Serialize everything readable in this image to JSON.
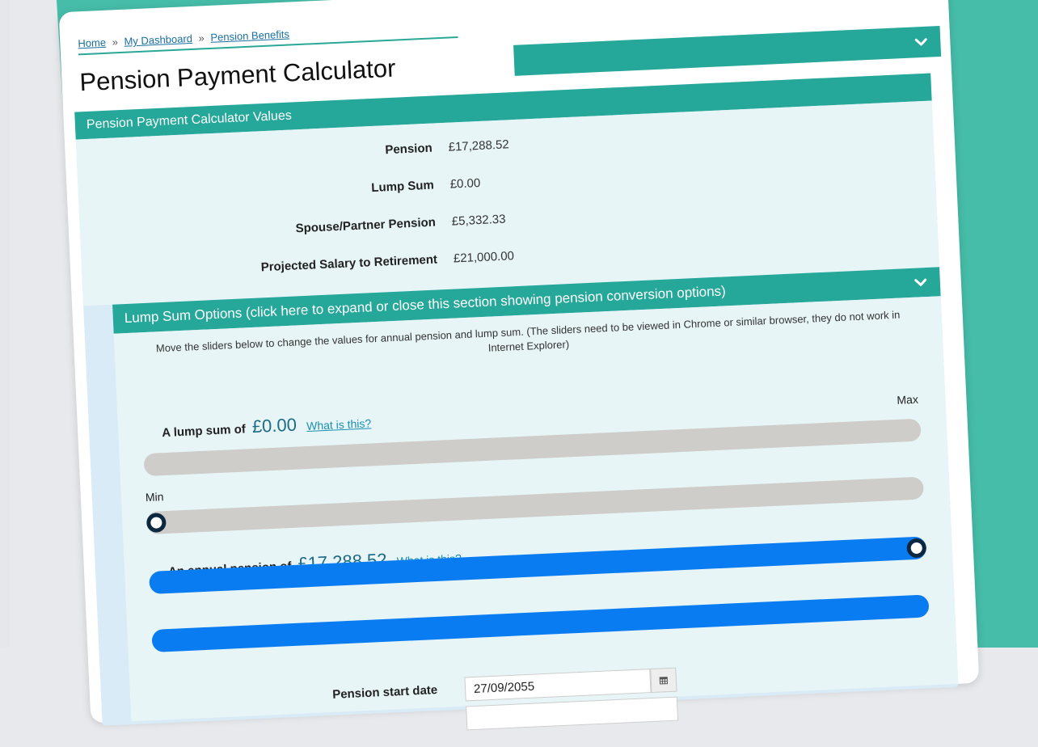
{
  "breadcrumb": {
    "home": "Home",
    "sep": "»",
    "dashboard": "My Dashboard",
    "benefits": "Pension Benefits"
  },
  "page": {
    "title": "Pension Payment Calculator"
  },
  "values_section": {
    "header": "Pension Payment Calculator Values",
    "rows": [
      {
        "label": "Pension",
        "value": "£17,288.52"
      },
      {
        "label": "Lump Sum",
        "value": "£0.00"
      },
      {
        "label": "Spouse/Partner Pension",
        "value": "£5,332.33"
      },
      {
        "label": "Projected Salary to Retirement",
        "value": "£21,000.00"
      }
    ]
  },
  "lump_options": {
    "header": "Lump Sum Options (click here to expand or close this section showing pension conversion options)",
    "instructions": "Move the sliders below to change the values for annual pension and lump sum. (The sliders need to be viewed in Chrome or similar browser, they do not work in Internet Explorer)",
    "lump_sum": {
      "prefix": "A lump sum of",
      "amount": "£0.00",
      "link": "What is this?",
      "max_label": "Max",
      "min_label": "Min",
      "level": 0.0
    },
    "annual_pension": {
      "prefix": "An annual pension of",
      "amount": "£17,288.52",
      "link": "What is this?",
      "level": 1.0
    },
    "start_date": {
      "label": "Pension start date",
      "value": "27/09/2055"
    }
  },
  "colors": {
    "teal": "#25a89a",
    "background_teal": "#46bda9",
    "slider_fill": "#0a7cf2",
    "link": "#1a8fb0"
  },
  "icons": {
    "collapse": "chevron-down-icon",
    "calendar": "calendar-icon"
  }
}
